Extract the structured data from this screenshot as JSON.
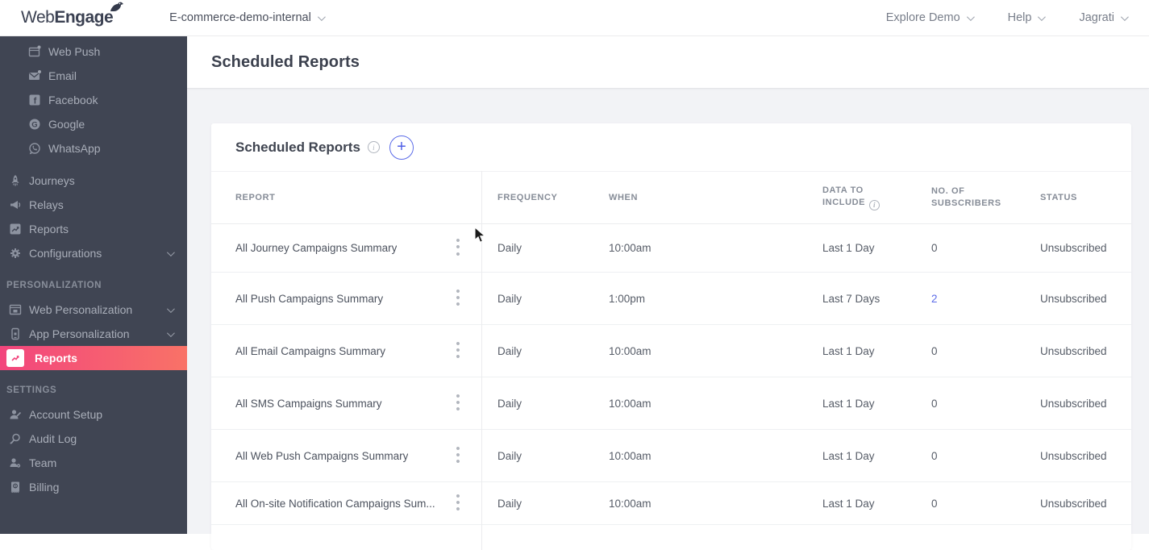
{
  "colors": {
    "sidebar_bg": "#404553",
    "active_gradient_start": "#f2457d",
    "active_gradient_end": "#f97267",
    "accent_indigo": "#5b6be8",
    "content_bg": "#f2f3f6",
    "link_color": "#5b6be8"
  },
  "icons": {
    "add": "+",
    "info": "i",
    "dot": "•"
  },
  "topbar": {
    "brand_light": "Web",
    "brand_bold": "Engage",
    "project_selector": "E-commerce-demo-internal",
    "menu_explore": "Explore Demo",
    "menu_help": "Help",
    "menu_user": "Jagrati"
  },
  "sidebar": {
    "channels": [
      {
        "label": "Web Push"
      },
      {
        "label": "Email"
      },
      {
        "label": "Facebook"
      },
      {
        "label": "Google"
      },
      {
        "label": "WhatsApp"
      }
    ],
    "main": [
      {
        "label": "Journeys"
      },
      {
        "label": "Relays"
      },
      {
        "label": "Reports"
      },
      {
        "label": "Configurations"
      }
    ],
    "personalization": {
      "title": "PERSONALIZATION",
      "items": [
        {
          "label": "Web Personalization"
        },
        {
          "label": "App Personalization"
        },
        {
          "label": "Reports"
        }
      ]
    },
    "settings": {
      "title": "SETTINGS",
      "items": [
        {
          "label": "Account Setup"
        },
        {
          "label": "Audit Log"
        },
        {
          "label": "Team"
        },
        {
          "label": "Billing"
        }
      ]
    }
  },
  "page": {
    "title": "Scheduled Reports"
  },
  "card": {
    "title": "Scheduled Reports",
    "columns": [
      {
        "label": "REPORT"
      },
      {
        "label": "FREQUENCY"
      },
      {
        "label": "WHEN"
      },
      {
        "label": "DATA TO INCLUDE",
        "has_info": true
      },
      {
        "label": "NO. OF SUBSCRIBERS"
      },
      {
        "label": "STATUS"
      }
    ],
    "rows": [
      {
        "report": "All Journey Campaigns Summary",
        "frequency": "Daily",
        "when": "10:00am",
        "data_to_include": "Last 1 Day",
        "subscribers": "0",
        "subscribers_link": false,
        "status": "Unsubscribed"
      },
      {
        "report": "All Push Campaigns Summary",
        "frequency": "Daily",
        "when": "1:00pm",
        "data_to_include": "Last 7 Days",
        "subscribers": "2",
        "subscribers_link": true,
        "status": "Unsubscribed"
      },
      {
        "report": "All Email Campaigns Summary",
        "frequency": "Daily",
        "when": "10:00am",
        "data_to_include": "Last 1 Day",
        "subscribers": "0",
        "subscribers_link": false,
        "status": "Unsubscribed"
      },
      {
        "report": "All SMS Campaigns Summary",
        "frequency": "Daily",
        "when": "10:00am",
        "data_to_include": "Last 1 Day",
        "subscribers": "0",
        "subscribers_link": false,
        "status": "Unsubscribed"
      },
      {
        "report": "All Web Push Campaigns Summary",
        "frequency": "Daily",
        "when": "10:00am",
        "data_to_include": "Last 1 Day",
        "subscribers": "0",
        "subscribers_link": false,
        "status": "Unsubscribed"
      },
      {
        "report": "All On-site Notification Campaigns Sum...",
        "frequency": "Daily",
        "when": "10:00am",
        "data_to_include": "Last 1 Day",
        "subscribers": "0",
        "subscribers_link": false,
        "status": "Unsubscribed"
      }
    ]
  }
}
